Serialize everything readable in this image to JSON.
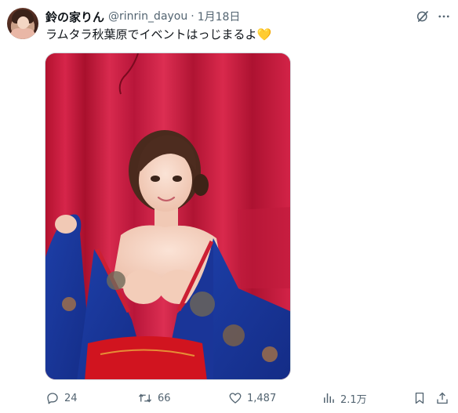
{
  "user": {
    "display_name": "鈴の家りん",
    "handle": "@rinrin_dayou",
    "separator": "·",
    "date": "1月18日"
  },
  "tweet": {
    "text": "ラムタラ秋葉原でイベントはっじまるよ💛"
  },
  "actions": {
    "replies": "24",
    "reposts": "66",
    "likes": "1,487",
    "views": "2.1万"
  },
  "icons": {
    "grok": "grok-icon",
    "more": "more-icon",
    "reply": "reply-icon",
    "repost": "repost-icon",
    "like": "heart-icon",
    "views": "views-chart-icon",
    "bookmark": "bookmark-icon",
    "share": "share-icon"
  },
  "colors": {
    "text_primary": "#0f1419",
    "text_secondary": "#536471",
    "background": "#ffffff",
    "media_border": "#cfd9de"
  }
}
